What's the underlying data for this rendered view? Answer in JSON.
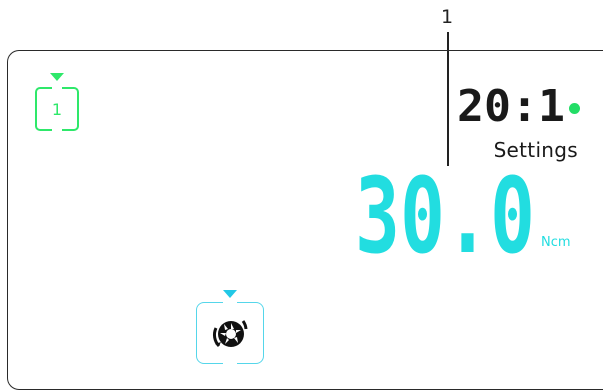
{
  "callout": {
    "number": "1"
  },
  "program": {
    "number": "1",
    "color": "#2ee86a"
  },
  "ratio": {
    "text": "20:1",
    "status_color": "#22dd66"
  },
  "settings": {
    "label": "Settings"
  },
  "torque": {
    "value": "30.0",
    "unit": "Ncm",
    "color": "#22dde0"
  },
  "rotation_mode": {
    "icon": "rotation-direction-icon",
    "color": "#55d6ea"
  }
}
